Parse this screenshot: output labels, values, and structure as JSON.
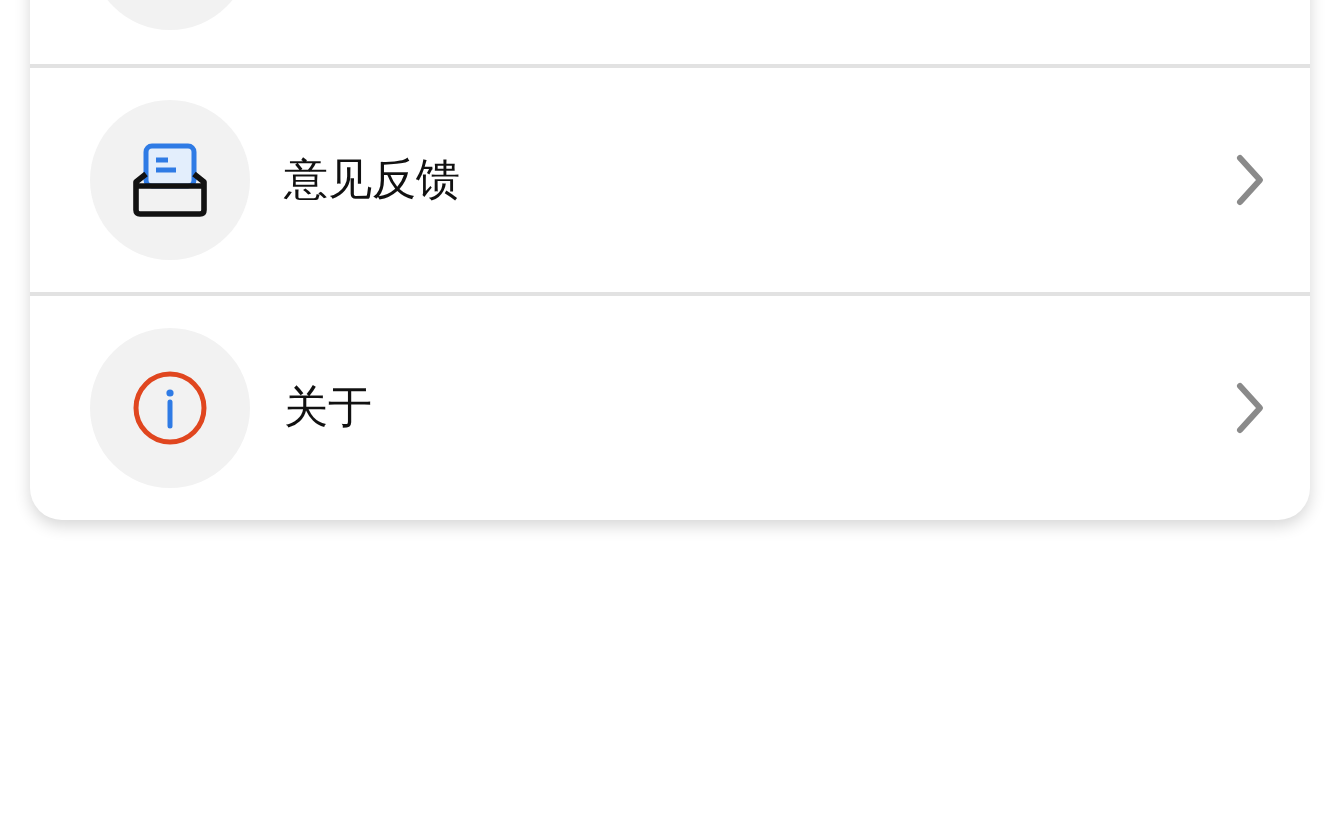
{
  "menu": [
    {
      "kind": "cut"
    },
    {
      "kind": "feedback",
      "label": "意见反馈"
    },
    {
      "kind": "info",
      "label": "关于"
    }
  ]
}
